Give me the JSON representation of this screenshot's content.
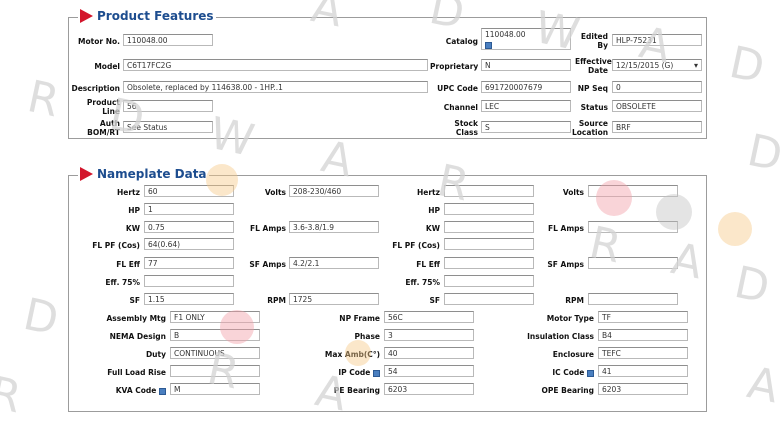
{
  "product_features": {
    "title": "Product Features",
    "motor_no_label": "Motor No.",
    "motor_no": "110048.00",
    "catalog_label": "Catalog",
    "catalog": "110048.00",
    "edited_by_label": "Edited By",
    "edited_by": "HLP-75231",
    "model_label": "Model",
    "model": "C6T17FC2G",
    "proprietary_label": "Proprietary",
    "proprietary": "N",
    "effective_date_label": "Effective Date",
    "effective_date": "12/15/2015 (G)",
    "description_label": "Description",
    "description": "Obsolete, replaced by 114638.00 - 1HP..1",
    "upc_label": "UPC Code",
    "upc": "691720007679",
    "np_seq_label": "NP Seq",
    "np_seq": "0",
    "product_line_label": "Product Line",
    "product_line": "56",
    "channel_label": "Channel",
    "channel": "LEC",
    "status_label": "Status",
    "status": "OBSOLETE",
    "auth_label": "Auth BOM/RT",
    "auth": "See Status",
    "stock_class_label": "Stock Class",
    "stock_class": "S",
    "source_location_label": "Source Location",
    "source_location": "BRF"
  },
  "nameplate": {
    "title": "Nameplate Data",
    "hertz_label": "Hertz",
    "hertz": "60",
    "volts_label": "Volts",
    "volts": "208-230/460",
    "hertz2_label": "Hertz",
    "hertz2": "",
    "volts2_label": "Volts",
    "volts2": "",
    "hp_label": "HP",
    "hp": "1",
    "hp2_label": "HP",
    "hp2": "",
    "kw_label": "KW",
    "kw": "0.75",
    "fl_amps_label": "FL Amps",
    "fl_amps": "3.6-3.8/1.9",
    "kw2_label": "KW",
    "kw2": "",
    "fl_amps2_label": "FL Amps",
    "fl_amps2": "",
    "fl_pf_label": "FL PF (Cos)",
    "fl_pf": "64(0.64)",
    "fl_pf2_label": "FL PF (Cos)",
    "fl_pf2": "",
    "fl_eff_label": "FL Eff",
    "fl_eff": "77",
    "sf_amps_label": "SF Amps",
    "sf_amps": "4.2/2.1",
    "fl_eff2_label": "FL Eff",
    "fl_eff2": "",
    "sf_amps2_label": "SF Amps",
    "sf_amps2": "",
    "eff75_label": "Eff. 75%",
    "eff75": "",
    "eff75_2_label": "Eff. 75%",
    "eff75_2": "",
    "sf_label": "SF",
    "sf": "1.15",
    "rpm_label": "RPM",
    "rpm": "1725",
    "sf2_label": "SF",
    "sf2": "",
    "rpm2_label": "RPM",
    "rpm2": "",
    "assembly_mtg_label": "Assembly Mtg",
    "assembly_mtg": "F1 ONLY",
    "np_frame_label": "NP Frame",
    "np_frame": "56C",
    "motor_type_label": "Motor Type",
    "motor_type": "TF",
    "nema_design_label": "NEMA Design",
    "nema_design": "B",
    "phase_label": "Phase",
    "phase": "3",
    "insulation_class_label": "Insulation Class",
    "insulation_class": "B4",
    "duty_label": "Duty",
    "duty": "CONTINUOUS",
    "max_amb_label": "Max Amb(C°)",
    "max_amb": "40",
    "enclosure_label": "Enclosure",
    "enclosure": "TEFC",
    "full_load_rise_label": "Full Load Rise",
    "full_load_rise": "",
    "ip_code_label": "IP Code",
    "ip_code": "54",
    "ic_code_label": "IC Code",
    "ic_code": "41",
    "kva_code_label": "KVA Code",
    "kva_code": "M",
    "pe_bearing_label": "PE Bearing",
    "pe_bearing": "6203",
    "ope_bearing_label": "OPE Bearing",
    "ope_bearing": "6203"
  },
  "watermark": {
    "w1": "A",
    "w2": "D",
    "w3": "W",
    "w4": "A",
    "w5": "R",
    "w6": "D",
    "w7": "W",
    "w8": "A",
    "w9": "R",
    "w10": "D",
    "w11": "R",
    "w12": "A",
    "w13": "D",
    "w14": "D",
    "w15": "R",
    "w16": "A",
    "w17": "R",
    "w18": "A",
    "w19": "D"
  },
  "icons": {
    "arrow": "red-chevron-icon",
    "calendar": "calendar-icon",
    "dropdown": "chevron-down-icon"
  },
  "colors": {
    "accent": "#d3162c",
    "title": "#1d4d8f",
    "border": "#9c9c9c"
  }
}
